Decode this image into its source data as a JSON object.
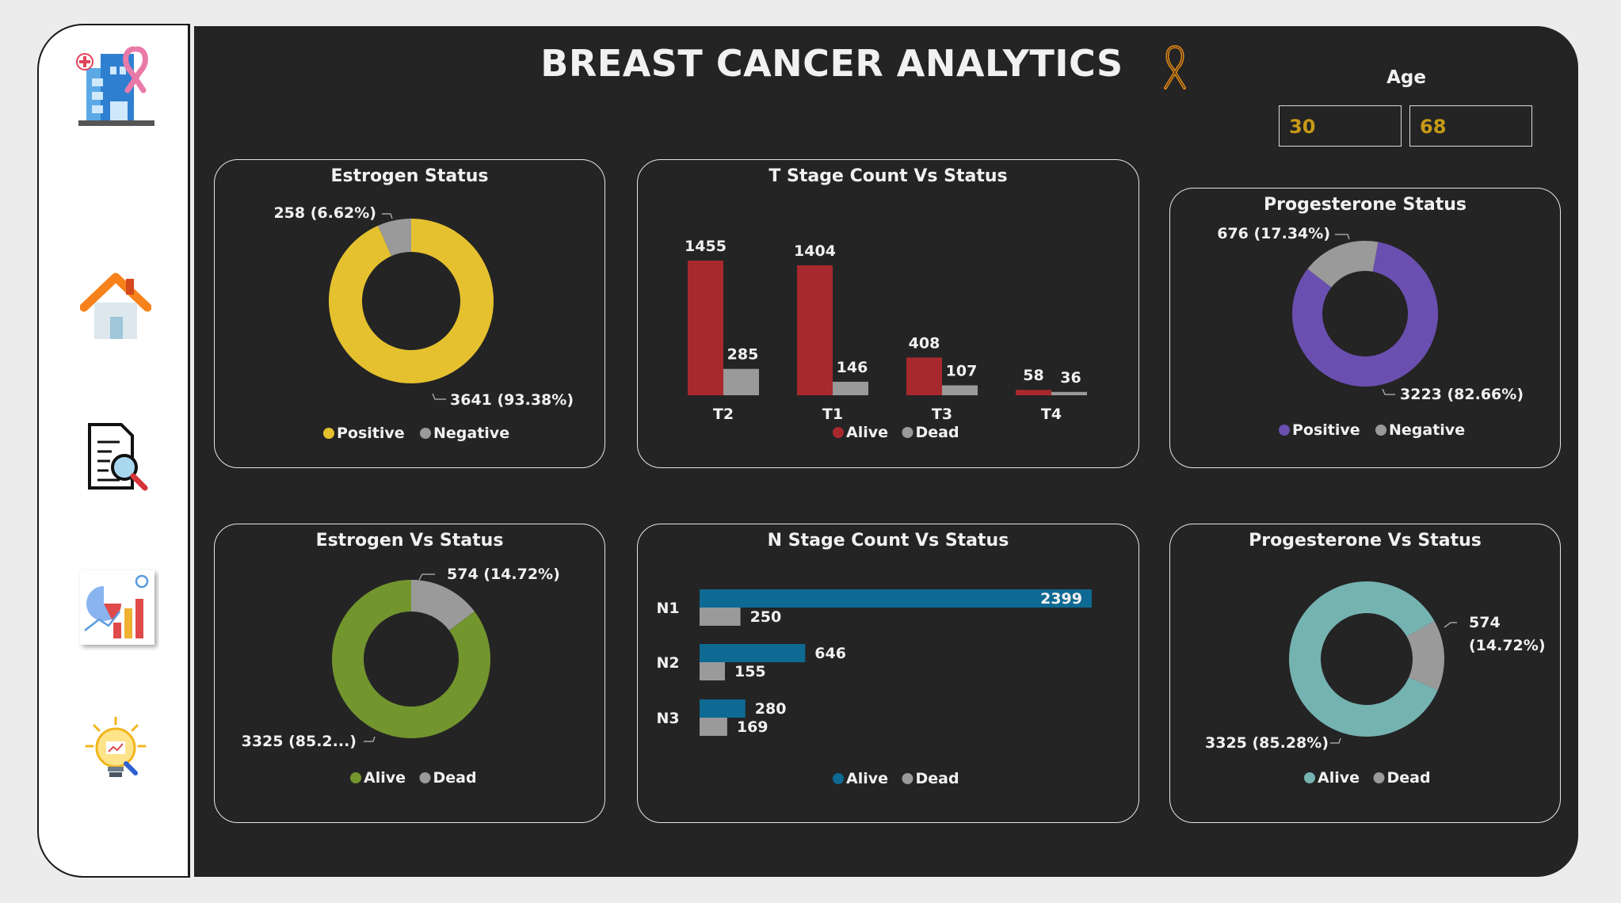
{
  "header": {
    "title": "BREAST CANCER ANALYTICS",
    "age_label": "Age",
    "age_min": "30",
    "age_max": "68"
  },
  "sidebar": {
    "items": [
      {
        "icon": "hospital-logo-icon"
      },
      {
        "icon": "home-icon"
      },
      {
        "icon": "report-search-icon"
      },
      {
        "icon": "charts-icon"
      },
      {
        "icon": "insights-lightbulb-icon"
      }
    ]
  },
  "colors": {
    "yellow": "#e5c12f",
    "gray": "#9a9a9a",
    "purple": "#6b4fb0",
    "red": "#a8292d",
    "blue": "#0e6a93",
    "green": "#73952e",
    "teal": "#75b3b1",
    "title_color": "#f1f1f1",
    "age_color": "#c79b17"
  },
  "estrogen_status": {
    "title": "Estrogen Status",
    "label_positive": "3641 (93.38%)",
    "label_negative": "258 (6.62%)",
    "legend": [
      "Positive",
      "Negative"
    ]
  },
  "t_stage": {
    "title": "T Stage Count Vs Status",
    "legend": [
      "Alive",
      "Dead"
    ]
  },
  "progesterone_status": {
    "title": "Progesterone Status",
    "label_positive": "3223 (82.66%)",
    "label_negative": "676 (17.34%)",
    "legend": [
      "Positive",
      "Negative"
    ]
  },
  "estrogen_vs_status": {
    "title": "Estrogen Vs Status",
    "label_alive": "3325 (85.2...)",
    "label_dead": "574 (14.72%)",
    "legend": [
      "Alive",
      "Dead"
    ]
  },
  "n_stage": {
    "title": "N Stage Count Vs Status",
    "legend": [
      "Alive",
      "Dead"
    ]
  },
  "progesterone_vs_status": {
    "title": "Progesterone Vs Status",
    "label_alive": "3325 (85.28%)",
    "label_dead_1": "574",
    "label_dead_2": "(14.72%)",
    "legend": [
      "Alive",
      "Dead"
    ]
  },
  "chart_data": [
    {
      "type": "pie",
      "title": "Estrogen Status",
      "categories": [
        "Positive",
        "Negative"
      ],
      "values": [
        3641,
        258
      ],
      "percent": [
        93.38,
        6.62
      ],
      "style": "donut",
      "legend": "bottom"
    },
    {
      "type": "bar",
      "title": "T Stage Count Vs Status",
      "categories": [
        "T2",
        "T1",
        "T3",
        "T4"
      ],
      "series": [
        {
          "name": "Alive",
          "values": [
            1455,
            1404,
            408,
            58
          ]
        },
        {
          "name": "Dead",
          "values": [
            285,
            146,
            107,
            36
          ]
        }
      ],
      "legend": "bottom"
    },
    {
      "type": "pie",
      "title": "Progesterone Status",
      "categories": [
        "Positive",
        "Negative"
      ],
      "values": [
        3223,
        676
      ],
      "percent": [
        82.66,
        17.34
      ],
      "style": "donut",
      "legend": "bottom"
    },
    {
      "type": "pie",
      "title": "Estrogen Vs Status",
      "categories": [
        "Alive",
        "Dead"
      ],
      "values": [
        3325,
        574
      ],
      "percent": [
        85.28,
        14.72
      ],
      "style": "donut",
      "legend": "bottom"
    },
    {
      "type": "bar",
      "orientation": "horizontal",
      "title": "N Stage Count Vs Status",
      "categories": [
        "N1",
        "N2",
        "N3"
      ],
      "series": [
        {
          "name": "Alive",
          "values": [
            2399,
            646,
            280
          ]
        },
        {
          "name": "Dead",
          "values": [
            250,
            155,
            169
          ]
        }
      ],
      "legend": "bottom"
    },
    {
      "type": "pie",
      "title": "Progesterone Vs Status",
      "categories": [
        "Alive",
        "Dead"
      ],
      "values": [
        3325,
        574
      ],
      "percent": [
        85.28,
        14.72
      ],
      "style": "donut",
      "legend": "bottom"
    }
  ]
}
